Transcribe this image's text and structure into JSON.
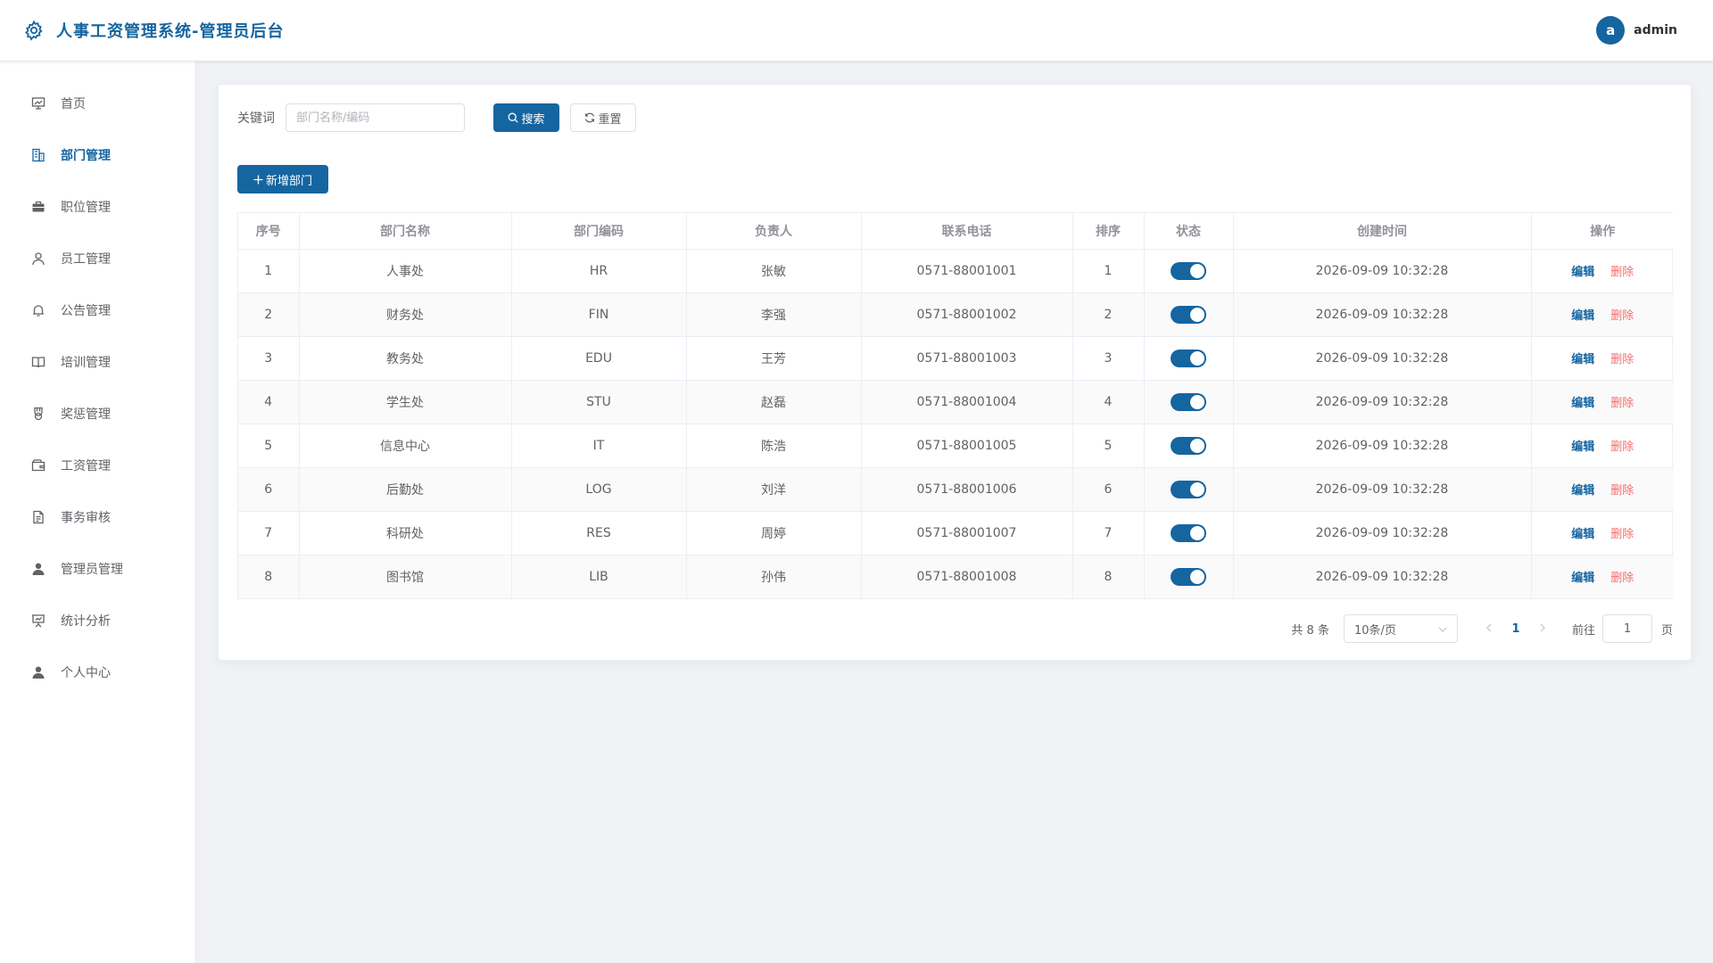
{
  "header": {
    "title": "人事工资管理系统-管理员后台",
    "avatar_letter": "a",
    "username": "admin"
  },
  "sidebar": {
    "items": [
      {
        "label": "首页",
        "icon": "chart-board-icon",
        "active": false
      },
      {
        "label": "部门管理",
        "icon": "building-icon",
        "active": true
      },
      {
        "label": "职位管理",
        "icon": "briefcase-icon",
        "active": false
      },
      {
        "label": "员工管理",
        "icon": "user-icon",
        "active": false
      },
      {
        "label": "公告管理",
        "icon": "bell-icon",
        "active": false
      },
      {
        "label": "培训管理",
        "icon": "book-icon",
        "active": false
      },
      {
        "label": "奖惩管理",
        "icon": "medal-icon",
        "active": false
      },
      {
        "label": "工资管理",
        "icon": "wallet-icon",
        "active": false
      },
      {
        "label": "事务审核",
        "icon": "document-icon",
        "active": false
      },
      {
        "label": "管理员管理",
        "icon": "user-filled-icon",
        "active": false
      },
      {
        "label": "统计分析",
        "icon": "presentation-icon",
        "active": false
      },
      {
        "label": "个人中心",
        "icon": "user-filled-icon",
        "active": false
      }
    ]
  },
  "search": {
    "label": "关键词",
    "placeholder": "部门名称/编码",
    "value": "",
    "search_button": "搜索",
    "reset_button": "重置"
  },
  "actions": {
    "add_button": "新增部门"
  },
  "table": {
    "columns": [
      "序号",
      "部门名称",
      "部门编码",
      "负责人",
      "联系电话",
      "排序",
      "状态",
      "创建时间",
      "操作"
    ],
    "rows": [
      {
        "index": "1",
        "name": "人事处",
        "code": "HR",
        "leader": "张敏",
        "phone": "0571-88001001",
        "sort": "1",
        "enabled": true,
        "created": "2026-09-09 10:32:28"
      },
      {
        "index": "2",
        "name": "财务处",
        "code": "FIN",
        "leader": "李强",
        "phone": "0571-88001002",
        "sort": "2",
        "enabled": true,
        "created": "2026-09-09 10:32:28"
      },
      {
        "index": "3",
        "name": "教务处",
        "code": "EDU",
        "leader": "王芳",
        "phone": "0571-88001003",
        "sort": "3",
        "enabled": true,
        "created": "2026-09-09 10:32:28"
      },
      {
        "index": "4",
        "name": "学生处",
        "code": "STU",
        "leader": "赵磊",
        "phone": "0571-88001004",
        "sort": "4",
        "enabled": true,
        "created": "2026-09-09 10:32:28"
      },
      {
        "index": "5",
        "name": "信息中心",
        "code": "IT",
        "leader": "陈浩",
        "phone": "0571-88001005",
        "sort": "5",
        "enabled": true,
        "created": "2026-09-09 10:32:28"
      },
      {
        "index": "6",
        "name": "后勤处",
        "code": "LOG",
        "leader": "刘洋",
        "phone": "0571-88001006",
        "sort": "6",
        "enabled": true,
        "created": "2026-09-09 10:32:28"
      },
      {
        "index": "7",
        "name": "科研处",
        "code": "RES",
        "leader": "周婷",
        "phone": "0571-88001007",
        "sort": "7",
        "enabled": true,
        "created": "2026-09-09 10:32:28"
      },
      {
        "index": "8",
        "name": "图书馆",
        "code": "LIB",
        "leader": "孙伟",
        "phone": "0571-88001008",
        "sort": "8",
        "enabled": true,
        "created": "2026-09-09 10:32:28"
      }
    ],
    "edit_label": "编辑",
    "delete_label": "删除"
  },
  "pagination": {
    "total_text": "共 8 条",
    "page_size": "10条/页",
    "current_page": "1",
    "goto_label": "前往",
    "goto_value": "1",
    "goto_suffix": "页"
  },
  "colors": {
    "primary": "#1565a0",
    "danger": "#f56c6c",
    "background": "#f0f2f5"
  }
}
